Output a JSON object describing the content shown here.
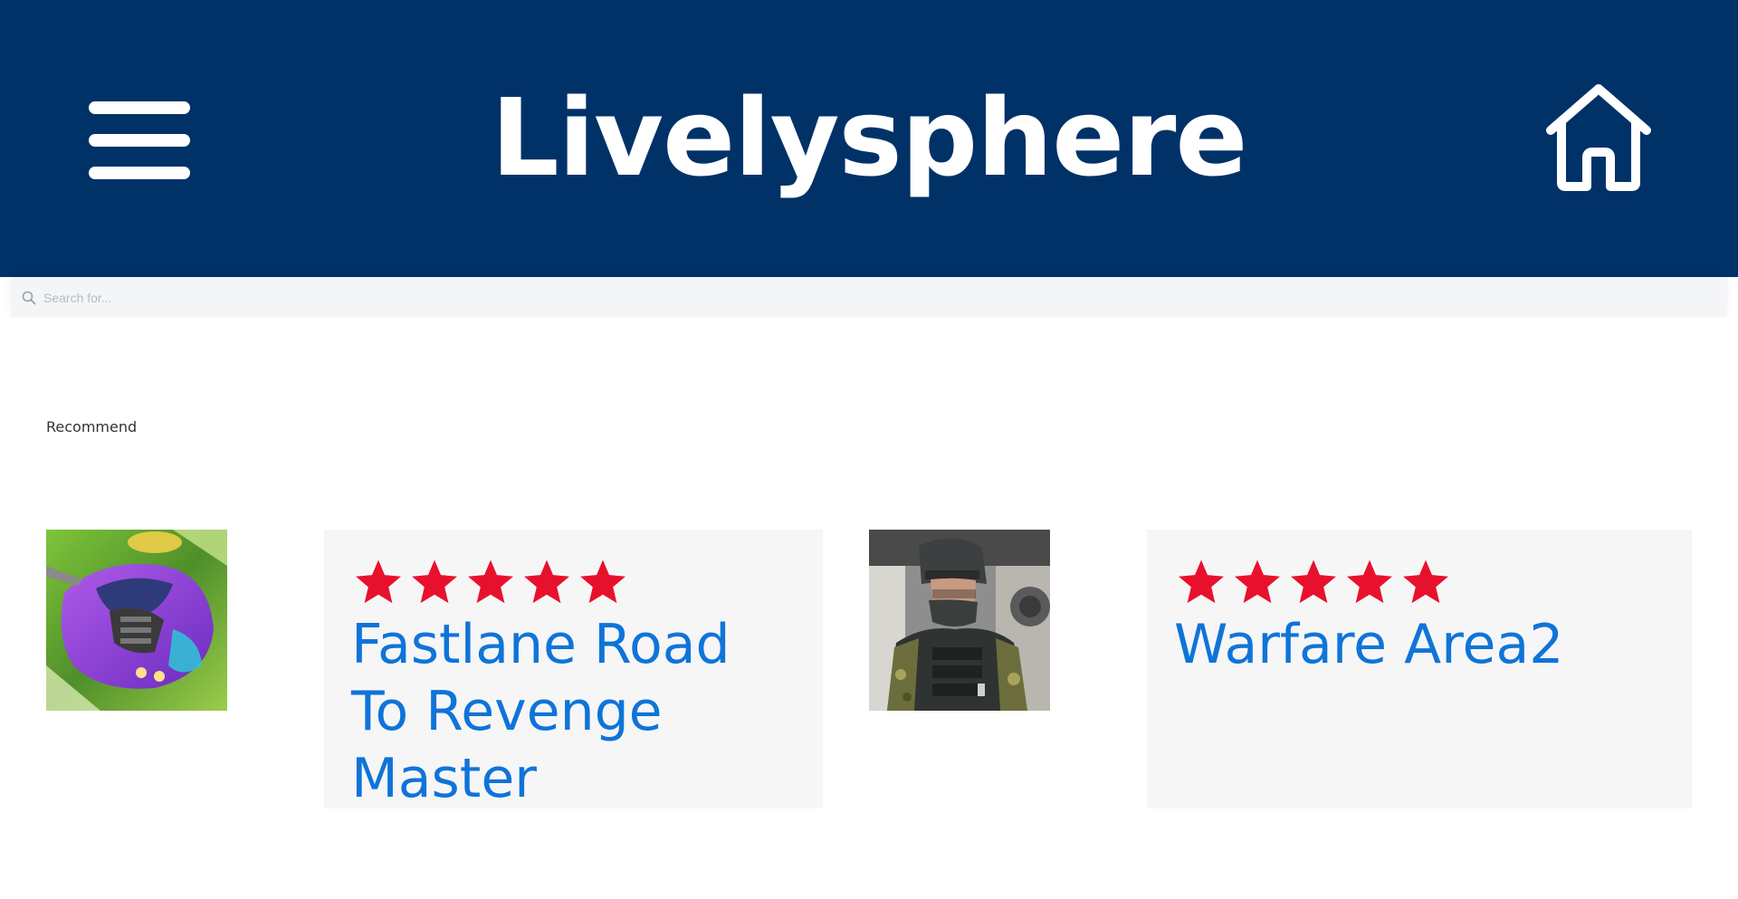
{
  "header": {
    "title": "Livelysphere",
    "menu_icon": "hamburger-menu-icon",
    "home_icon": "home-icon",
    "background": "#003268"
  },
  "search": {
    "placeholder": "Search for...",
    "value": "",
    "icon": "search-icon"
  },
  "section": {
    "label": "Recommend"
  },
  "games": [
    {
      "title": "Fastlane Road To Revenge Master",
      "rating": 5,
      "thumbnail": "purple racing car"
    },
    {
      "title": "Warfare Area2",
      "rating": 5,
      "thumbnail": "soldier with helmet"
    }
  ],
  "colors": {
    "accent_link": "#0f74d8",
    "star": "#e8112d",
    "card_bg": "#f6f6f7"
  }
}
